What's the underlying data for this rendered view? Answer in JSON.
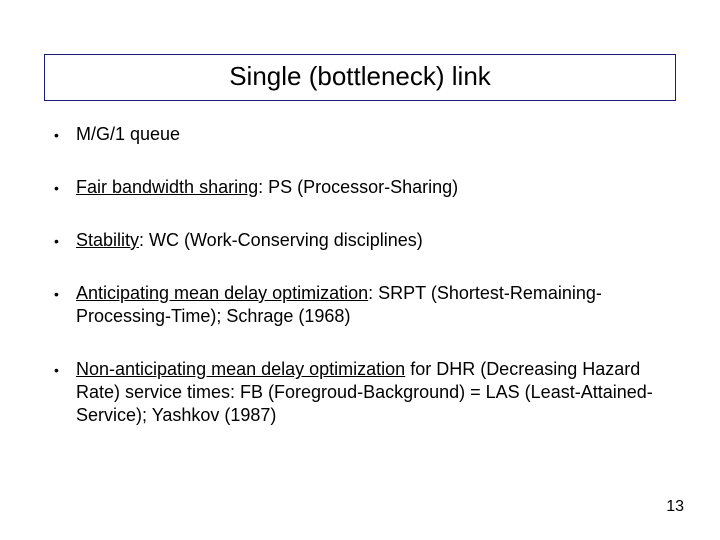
{
  "title": "Single (bottleneck) link",
  "bullets": [
    {
      "plain": "M/G/1 queue"
    },
    {
      "ul": "Fair bandwidth sharing",
      "rest": ": PS (Processor-Sharing)"
    },
    {
      "ul": "Stability",
      "rest": ": WC (Work-Conserving disciplines)"
    },
    {
      "ul": "Anticipating mean delay optimization",
      "rest": ": SRPT (Shortest-Remaining-Processing-Time); Schrage (1968)"
    },
    {
      "ul": "Non-anticipating mean delay optimization",
      "rest": " for DHR (Decreasing Hazard Rate) service times: FB (Foregroud-Background) = LAS (Least-Attained-Service); Yashkov (1987)"
    }
  ],
  "page_number": "13"
}
